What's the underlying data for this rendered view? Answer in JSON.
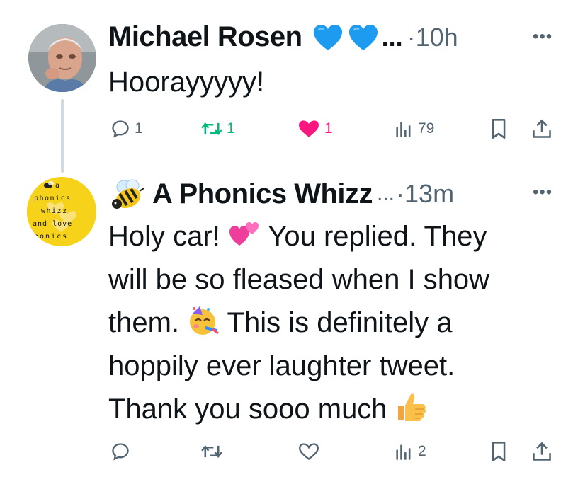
{
  "tweets": [
    {
      "author": "Michael Rosen",
      "badges": [
        "blue-heart",
        "blue-heart"
      ],
      "ellipsis": "...",
      "time": "·10h",
      "text": [
        "Hoorayyyyy!"
      ],
      "actions": {
        "replies": "1",
        "reposts": "1",
        "likes": "1",
        "views": "79"
      },
      "liked": true
    },
    {
      "author": "A Phonics Whizz",
      "author_prefix_emoji": "bee",
      "ellipsis": "...",
      "time": "·13m",
      "avatar_text": [
        "a",
        "phonics",
        "whizz",
        "and love",
        "phonics"
      ],
      "text_lines": [
        "Holy car! ",
        " You replied. They",
        "will be so fleased when I show",
        "them. ",
        " This is definitely a",
        "hoppily ever laughter tweet.",
        "Thank you sooo much "
      ],
      "actions": {
        "views": "2"
      }
    }
  ],
  "more_icon": "more-options-icon",
  "colors": {
    "accent_blue": "#1d9bf0",
    "like_pink": "#f91880",
    "repost_green": "#00ba7c",
    "secondary": "#536471"
  }
}
